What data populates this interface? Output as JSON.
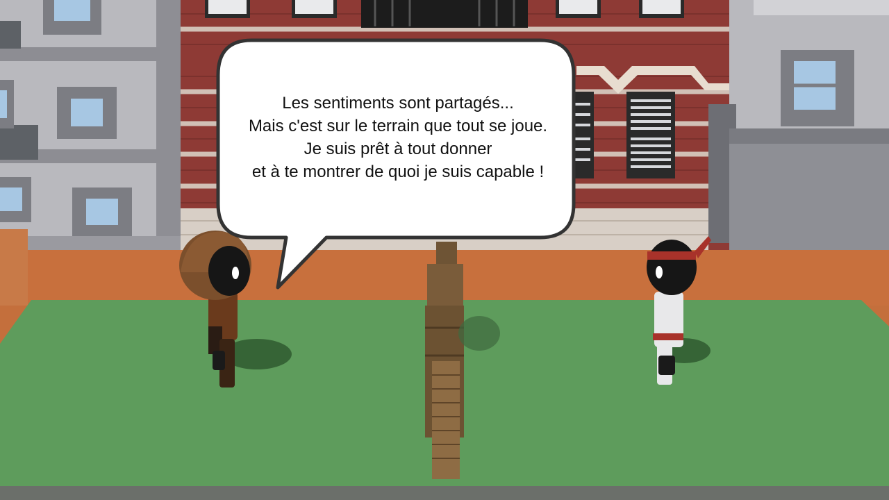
{
  "dialogue": {
    "lines": [
      "Les sentiments sont partagés...",
      "Mais c'est sur le terrain que tout se joue.",
      "Je suis prêt à tout donner",
      "et à te montrer de quoi je suis capable !"
    ]
  },
  "colors": {
    "field": "#5e9c5c",
    "brick": "#8e3a35",
    "building_grey": "#b9b9be",
    "bubble_fill": "#ffffff",
    "bubble_border": "#333333",
    "headband": "#a8322a"
  }
}
